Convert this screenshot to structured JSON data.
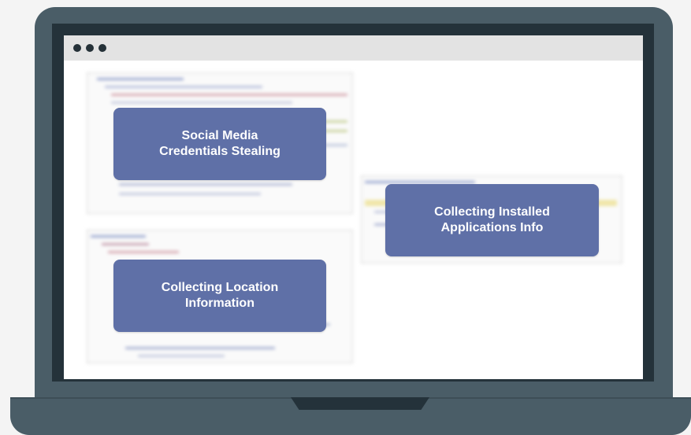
{
  "callouts": {
    "social_media": "Social Media\nCredentials Stealing",
    "location": "Collecting Location\nInformation",
    "installed_apps": "Collecting Installed\nApplications Info"
  },
  "window": {
    "control_icons": [
      "window-dot-icon",
      "window-dot-icon",
      "window-dot-icon"
    ]
  },
  "colors": {
    "laptop_body": "#4a5d67",
    "bezel": "#24323a",
    "callout_bg": "#5f70a7",
    "title_bar": "#e3e3e3",
    "page_bg": "#f4f4f4"
  }
}
